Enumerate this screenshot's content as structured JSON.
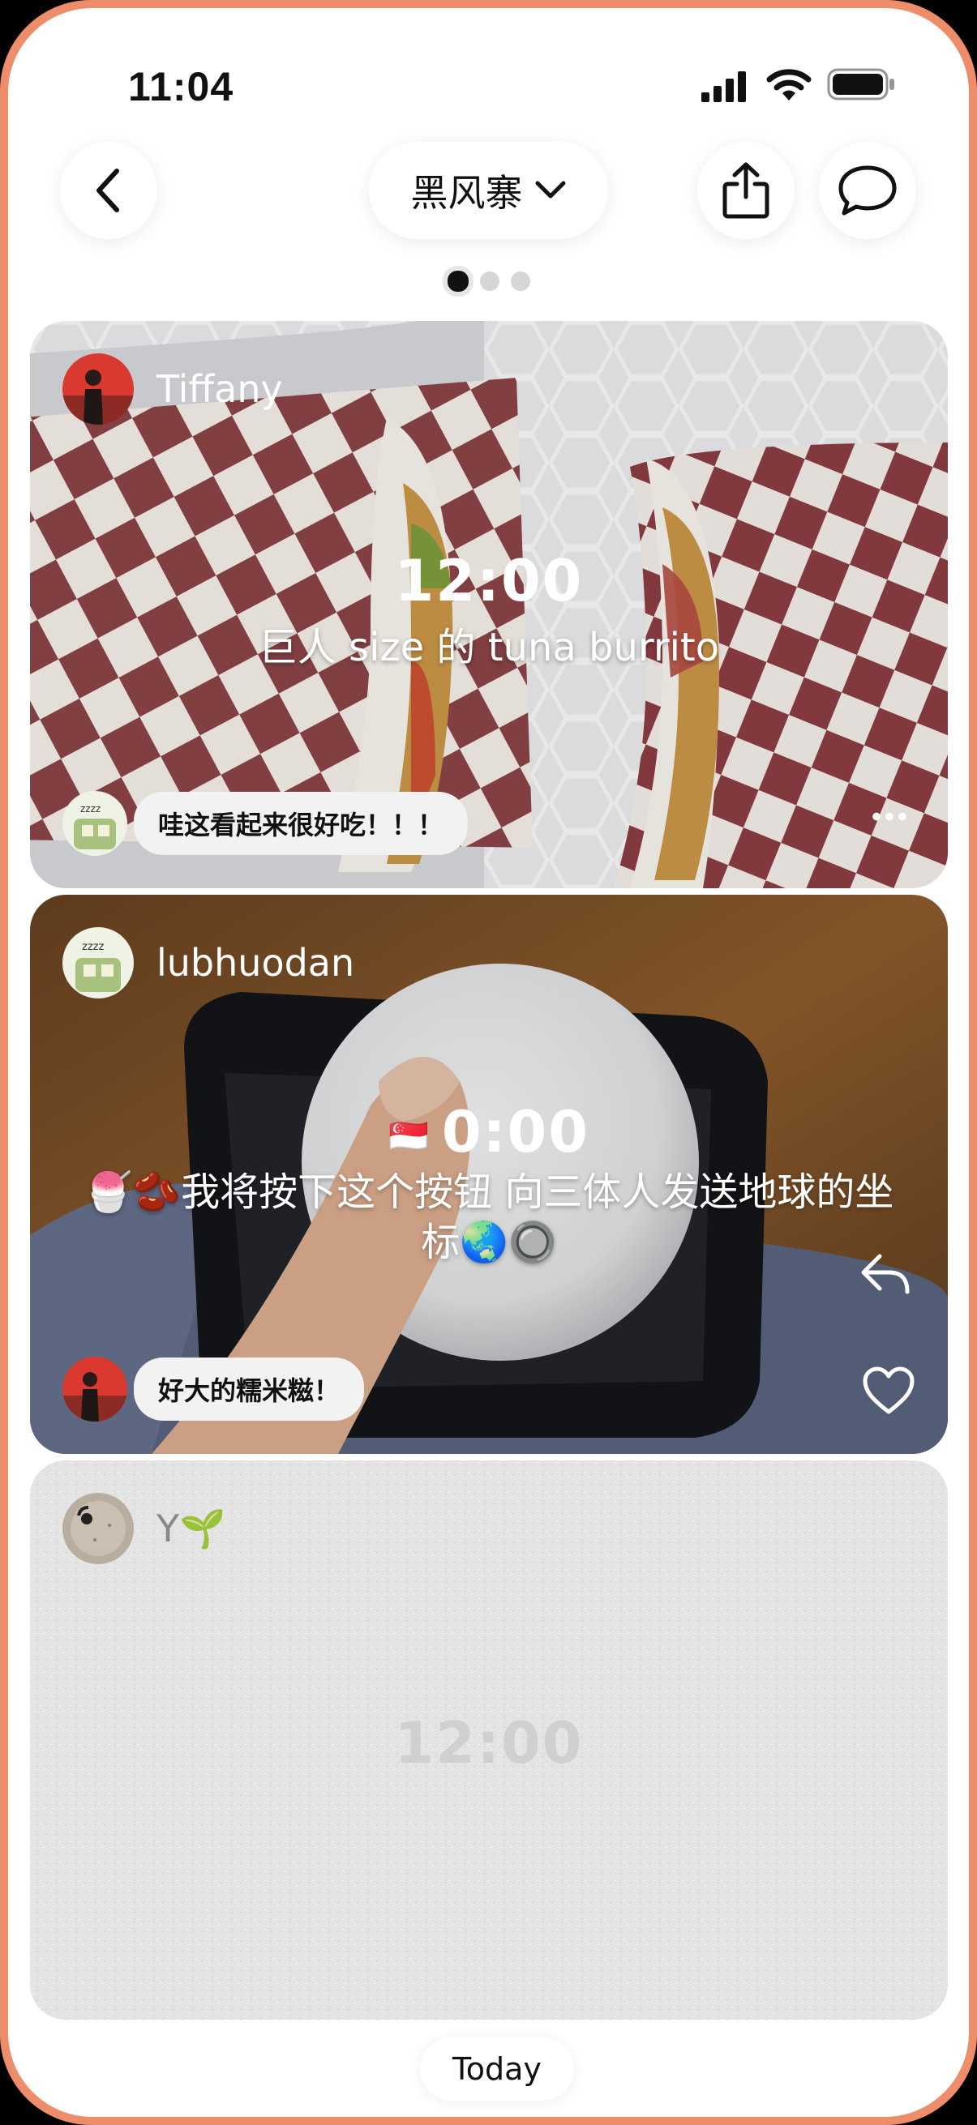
{
  "status_bar": {
    "time": "11:04"
  },
  "header": {
    "title": "黑风寨",
    "page_count": 3,
    "active_page": 1
  },
  "posts": [
    {
      "author": "Tiffany",
      "time": "12:00",
      "caption": "巨人 size 的 tuna burrito",
      "comment": "哇这看起来很好吃！！！",
      "more": "•••"
    },
    {
      "author": "lubhuodan",
      "flag": "🇸🇬",
      "time": "0:00",
      "caption": "🍧🫘我将按下这个按钮 向三体人发送地球的坐标🌏🔘",
      "comment": "好大的糯米糍！"
    },
    {
      "author": "Y🌱",
      "time": "12:00"
    }
  ],
  "footer": {
    "date_label": "Today"
  },
  "colors": {
    "frame": "#ee8d6a",
    "accent_dark": "#111111",
    "pending_card": "#e4e4e4"
  }
}
